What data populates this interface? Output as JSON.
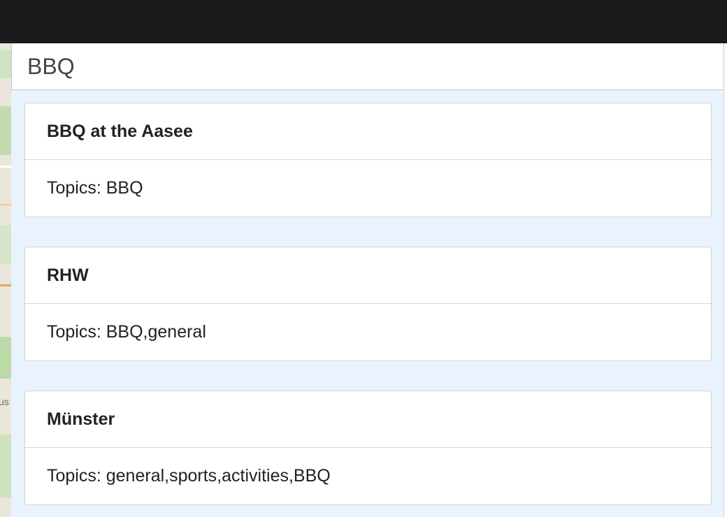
{
  "search": {
    "value": "BBQ"
  },
  "results": [
    {
      "title": "BBQ at the Aasee",
      "topics": "Topics: BBQ"
    },
    {
      "title": "RHW",
      "topics": "Topics: BBQ,general"
    },
    {
      "title": "Münster",
      "topics": "Topics: general,sports,activities,BBQ"
    }
  ],
  "map": {
    "partial_label": "us"
  },
  "colors": {
    "topbar": "#1b1b1b",
    "results_background": "#e9f3fd",
    "card_border": "#d2d2d2"
  }
}
